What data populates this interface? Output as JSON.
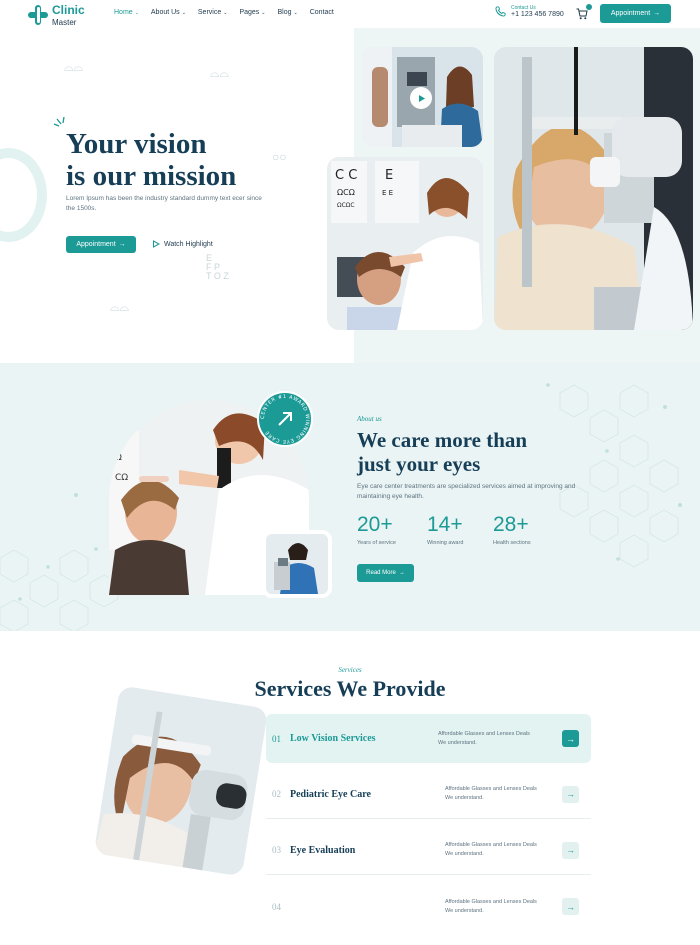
{
  "brand": {
    "name_line1": "Clinic",
    "name_line2": "Master",
    "accent": "#1c9a96",
    "dark": "#163e57"
  },
  "nav": {
    "items": [
      {
        "label": "Home",
        "has_caret": true,
        "active": true
      },
      {
        "label": "About Us",
        "has_caret": true
      },
      {
        "label": "Service",
        "has_caret": true
      },
      {
        "label": "Pages",
        "has_caret": true
      },
      {
        "label": "Blog",
        "has_caret": true
      },
      {
        "label": "Contact",
        "has_caret": false
      }
    ],
    "caret": "⌄",
    "contact_label": "Contact Us",
    "contact_phone": "+1 123 456 7890",
    "cta_label": "Appointment",
    "cart_icon": "cart-icon",
    "phone_icon": "phone-icon"
  },
  "hero": {
    "title_line1": "Your vision",
    "title_line2": "is our mission",
    "subtitle": "Lorem Ipsum has been the industry standard dummy text ecer since the 1500s.",
    "cta_label": "Appointment",
    "watch_label": "Watch Highlight",
    "arrow": "→"
  },
  "about": {
    "kicker": "About us",
    "title_line1": "We care more than",
    "title_line2": "just your eyes",
    "text": "Eye care center treatments are specialized services aimed at improving and maintaining eye health.",
    "award_text": "CENTER #1 AWARD WINNING EYE CARE",
    "stats": [
      {
        "value": "20+",
        "label": "Years of service"
      },
      {
        "value": "14+",
        "label": "Winning award"
      },
      {
        "value": "28+",
        "label": "Health sections"
      }
    ],
    "button_label": "Read More"
  },
  "services": {
    "kicker": "Services",
    "title": "Services We Provide",
    "items": [
      {
        "no": "01",
        "name": "Low Vision Services",
        "desc": "Affordable Glasses and Lenses Deals We understand."
      },
      {
        "no": "02",
        "name": "Pediatric Eye Care",
        "desc": "Affordable Glasses and Lenses Deals We understand."
      },
      {
        "no": "03",
        "name": "Eye Evaluation",
        "desc": "Affordable Glasses and Lenses Deals We understand."
      },
      {
        "no": "04",
        "name": "",
        "desc": "Affordable Glasses and Lenses Deals We understand."
      }
    ],
    "arrow": "→"
  }
}
